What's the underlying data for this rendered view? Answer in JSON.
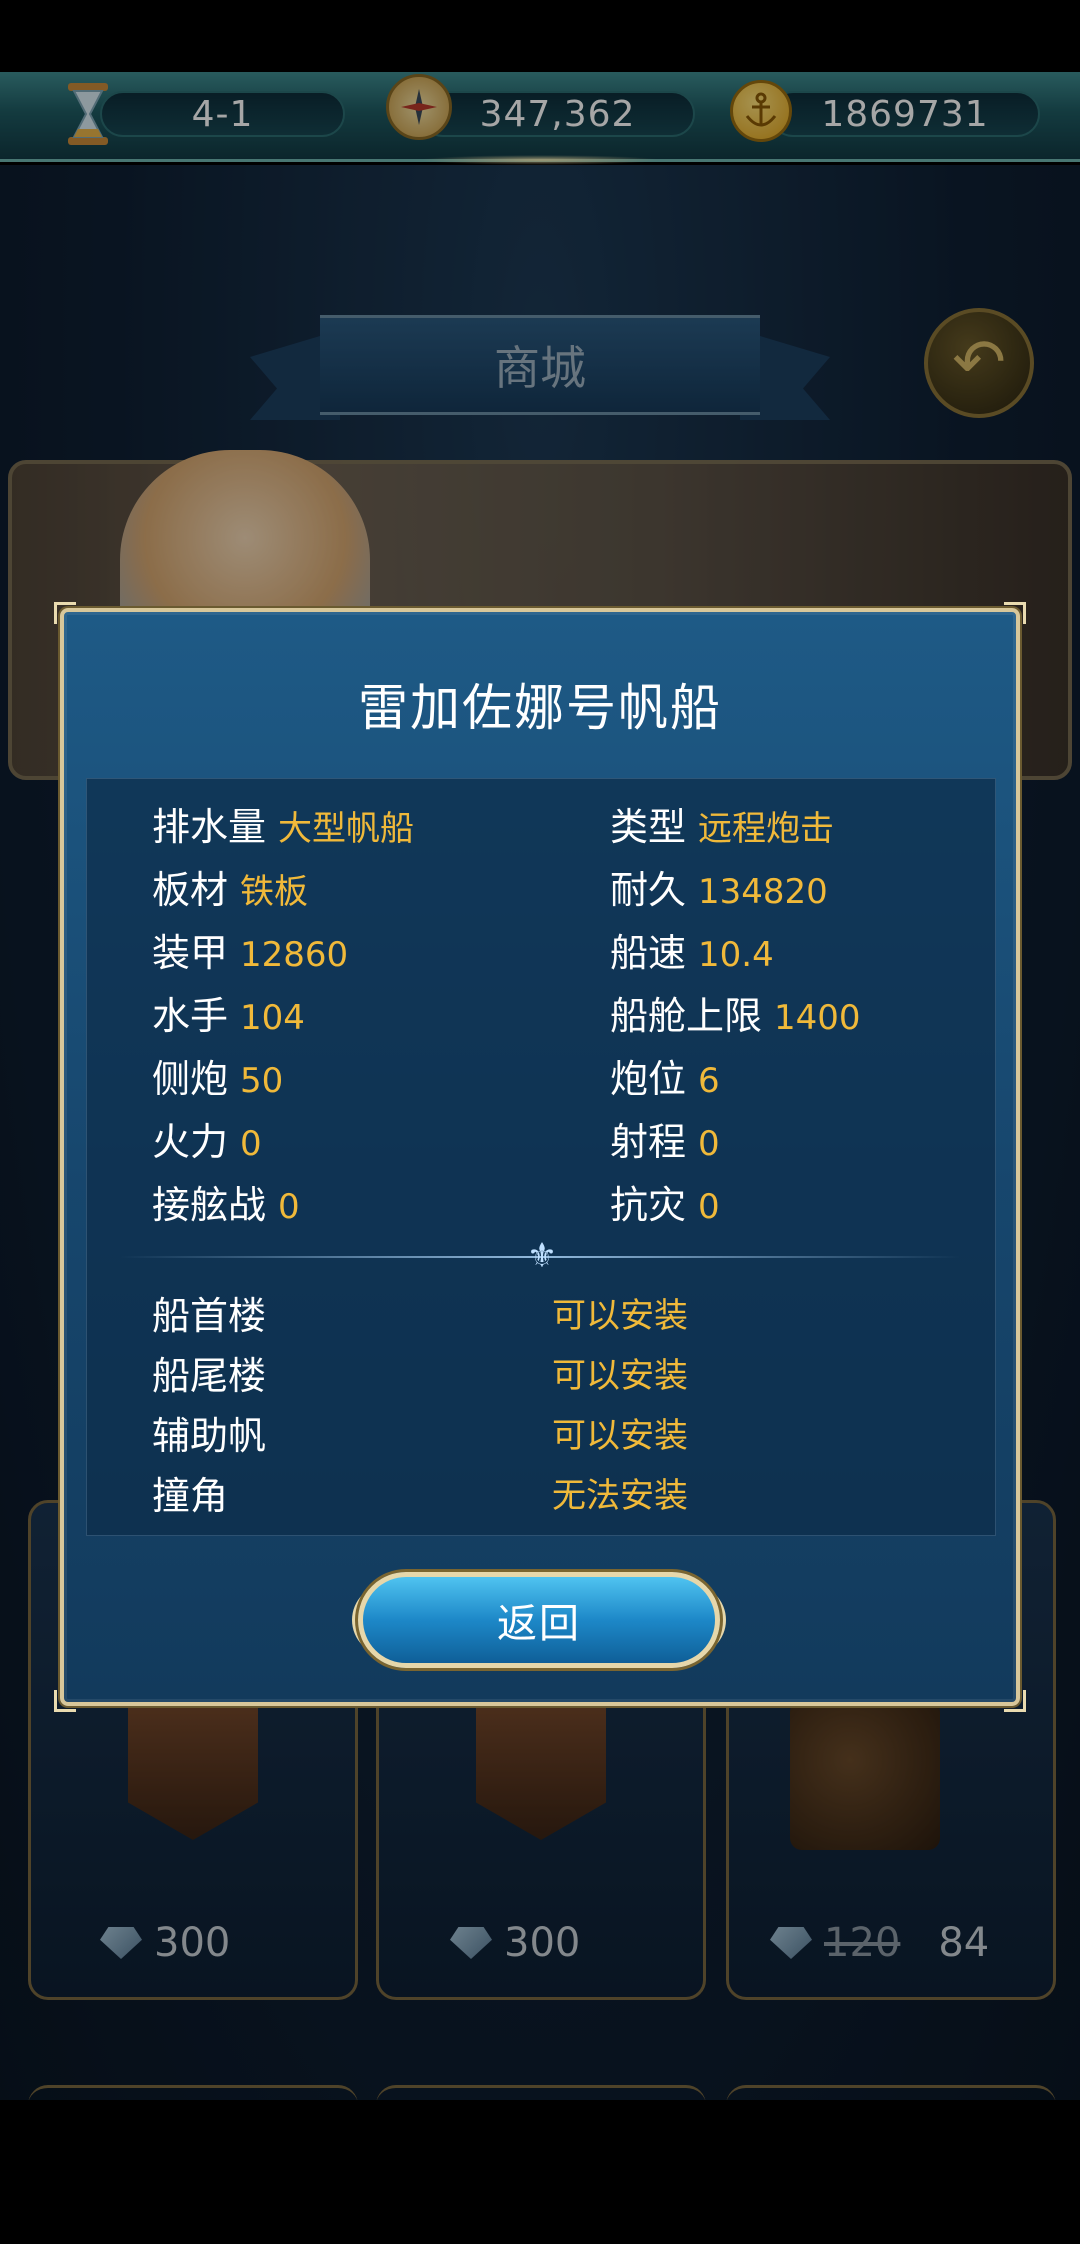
{
  "resources": {
    "stage": "4-1",
    "exploration": "347,362",
    "gold": "1869731",
    "icons": [
      "hourglass-icon",
      "compass-icon",
      "anchor-coin-icon"
    ]
  },
  "background": {
    "banner_title": "商城",
    "cards": [
      {
        "price": "300"
      },
      {
        "price": "300"
      },
      {
        "old_price": "120",
        "price": "84"
      }
    ]
  },
  "dialog": {
    "title": "雷加佐娜号帆船",
    "stats_left": [
      {
        "label": "排水量",
        "value": "大型帆船"
      },
      {
        "label": "板材",
        "value": "铁板"
      },
      {
        "label": "装甲",
        "value": "12860"
      },
      {
        "label": "水手",
        "value": "104"
      },
      {
        "label": "侧炮",
        "value": "50"
      },
      {
        "label": "火力",
        "value": "0"
      },
      {
        "label": "接舷战",
        "value": "0"
      }
    ],
    "stats_right": [
      {
        "label": "类型",
        "value": "远程炮击"
      },
      {
        "label": "耐久",
        "value": "134820"
      },
      {
        "label": "船速",
        "value": "10.4"
      },
      {
        "label": "船舱上限",
        "value": "1400"
      },
      {
        "label": "炮位",
        "value": "6"
      },
      {
        "label": "射程",
        "value": "0"
      },
      {
        "label": "抗灾",
        "value": "0"
      }
    ],
    "slots": [
      {
        "name": "船首楼",
        "status": "可以安装"
      },
      {
        "name": "船尾楼",
        "status": "可以安装"
      },
      {
        "name": "辅助帆",
        "status": "可以安装"
      },
      {
        "name": "撞角",
        "status": "无法安装"
      }
    ],
    "back_label": "返回"
  },
  "colors": {
    "value_gold": "#f0b93a",
    "modal_blue": "#1e5a86",
    "frame_gold": "#d8c79a"
  }
}
